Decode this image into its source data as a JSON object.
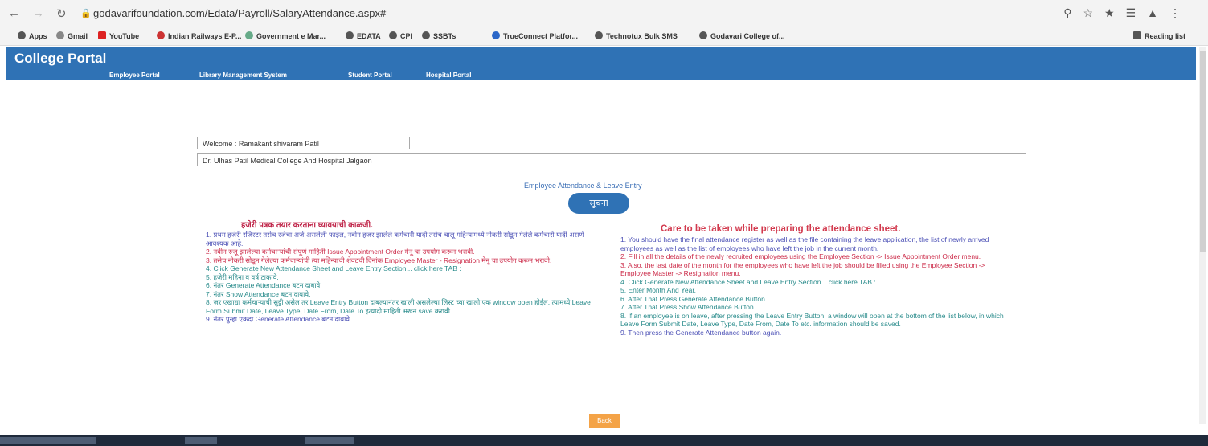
{
  "browser": {
    "url": "godavarifoundation.com/Edata/Payroll/SalaryAttendance.aspx#",
    "bookmarks": [
      "Apps",
      "Gmail",
      "YouTube",
      "Indian Railways E-P...",
      "Government e Mar...",
      "EDATA",
      "CPI",
      "SSBTs",
      "TrueConnect Platfor...",
      "Technotux Bulk SMS",
      "Godavari College of...",
      "Reading list"
    ]
  },
  "portal": {
    "title": "College Portal",
    "menu": [
      "Employee Portal",
      "Library Management System",
      "Student Portal",
      "Hospital Portal"
    ]
  },
  "welcome_field": "Welcome : Ramakant shivaram Patil",
  "college_field": "Dr. Ulhas Patil Medical College And Hospital Jalgaon",
  "page_link": "Employee Attendance & Leave Entry",
  "notice_button": "सूचना",
  "left": {
    "heading": "हजेरी पत्रक तयार करताना घ्यावयाची काळजी.",
    "lines": [
      "1. प्रथम हजेरी रजिस्टर तसेच रजेचा अर्ज असलेली फाईल, नवीन हजर झालेले कर्मचारी यादी तसेच चालू महिन्यामध्ये नोकरी सोडून गेलेले कर्मचारी यादी असणे आवश्यक आहे.",
      "2. नवीन रुजू झालेल्या कर्मचाऱ्यांची संपूर्ण माहिती Issue Appointment Order मेनू चा उपयोग करून भरावी.",
      "3. तसेच नोकरी सोडून गेलेल्या कर्मचाऱ्यांची त्या महिन्याची शेवटची दिनांक Employee Master - Resignation मेनू चा उपयोग करून भरावी.",
      "4. Click Generate New Attendance Sheet and Leave Entry Section... click here TAB :",
      "5. हजेरी महिना व वर्ष टाकावे.",
      "6. नंतर Generate Attendance बटन दाबावे.",
      "7. नंतर Show Attendance बटन दाबावे.",
      "8. जर एखाद्या कर्मचाऱ्याची सुट्टी असेल तर Leave Entry Button दाबल्यानंतर खाली असलेल्या लिस्ट च्या खाली एक window open होईल, त्यामध्ये Leave Form Submit Date, Leave Type, Date From, Date To इत्यादी माहिती भरून save करावी.",
      "9. नंतर पुन्हा एकदा Generate Attendance बटन दाबावे."
    ]
  },
  "right": {
    "heading": "Care to be taken while preparing the attendance sheet.",
    "lines": [
      "1. You should have the final attendance register as well as the file containing the leave application, the list of newly arrived employees as well as the list of employees who have left the job in the current month.",
      "2. Fill in all the details of the newly recruited employees using the Employee Section -> Issue Appointment Order menu.",
      "3. Also, the last date of the month for the employees who have left the job should be filled using the Employee Section -> Employee Master -> Resignation menu.",
      "4. Click Generate New Attendance Sheet and Leave Entry Section... click here TAB :",
      "5. Enter Month And Year.",
      "6. After That Press Generate Attendance Button.",
      "7. After That Press Show Attendance Button.",
      "8. If an employee is on leave, after pressing the Leave Entry Button, a window will open at the bottom of the list below, in which Leave Form Submit Date, Leave Type, Date From, Date To etc. information should be saved.",
      "9. Then press the Generate Attendance button again."
    ]
  },
  "back_button": "Back",
  "colors": {
    "header": "#2f72b5",
    "red": "#cc2c4a",
    "blue": "#4a4fb5",
    "teal": "#278a8a",
    "back": "#f4a347"
  }
}
